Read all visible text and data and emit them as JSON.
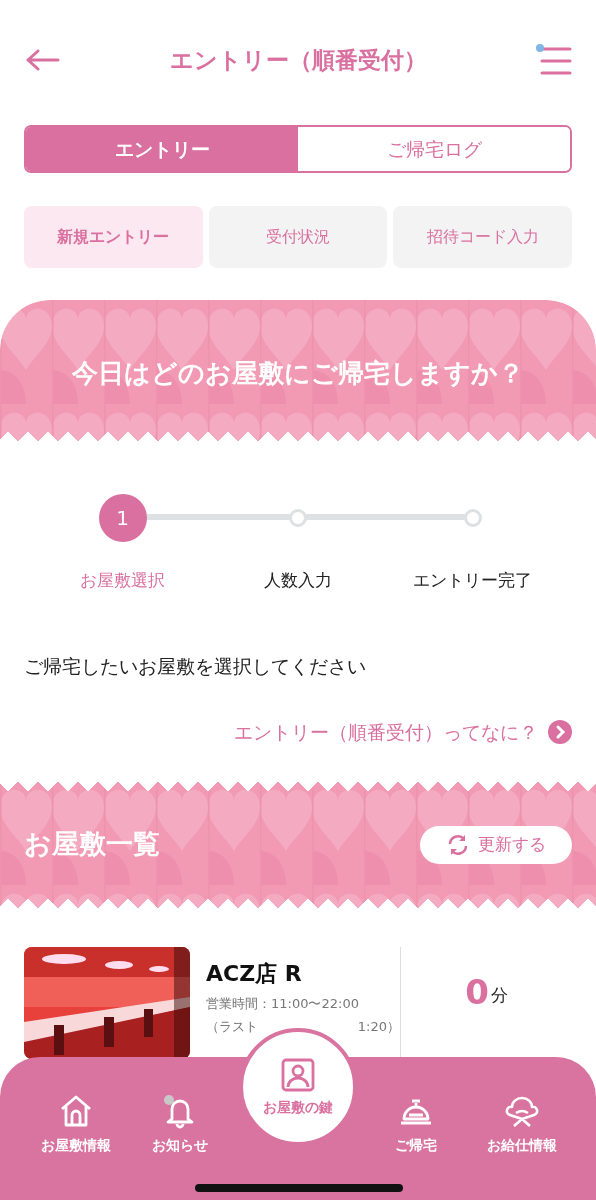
{
  "header": {
    "title": "エントリー（順番受付）",
    "menu_badge": true
  },
  "tabs": [
    {
      "label": "エントリー",
      "selected": true
    },
    {
      "label": "ご帰宅ログ",
      "selected": false
    }
  ],
  "subtabs": [
    {
      "label": "新規エントリー",
      "selected": true
    },
    {
      "label": "受付状況",
      "selected": false
    },
    {
      "label": "招待コード入力",
      "selected": false
    }
  ],
  "hero": {
    "title": "今日はどのお屋敷にご帰宅しますか？"
  },
  "steps": [
    {
      "number": "1",
      "label": "お屋敷選択",
      "current": true
    },
    {
      "label": "人数入力",
      "current": false
    },
    {
      "label": "エントリー完了",
      "current": false
    }
  ],
  "instruction": "ご帰宅したいお屋敷を選択してください",
  "help_link": "エントリー（順番受付）ってなに？",
  "shop_list": {
    "title": "お屋敷一覧",
    "refresh_button": "更新する",
    "shops": [
      {
        "name": "ACZ店 R",
        "hours": "営業時間：11:00〜22:00",
        "last_order_start": "（ラスト",
        "last_order_end": "1:20）",
        "wait": "0",
        "wait_unit": "分"
      }
    ]
  },
  "bottom_nav": [
    {
      "label": "お屋敷情報",
      "kind": "tab",
      "unread": false
    },
    {
      "label": "お知らせ",
      "kind": "tab",
      "unread": true
    },
    {
      "label": "お屋敷の鍵",
      "kind": "center",
      "unread": false
    },
    {
      "label": "ご帰宅",
      "kind": "tab",
      "unread": false
    },
    {
      "label": "お給仕情報",
      "kind": "tab",
      "unread": false
    }
  ]
}
